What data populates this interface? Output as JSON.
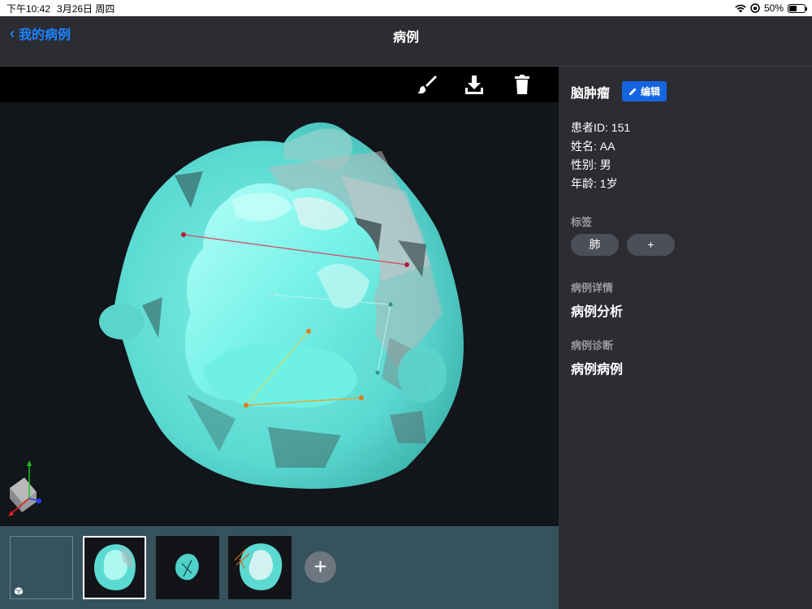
{
  "status_bar": {
    "time": "下午10:42",
    "date": "3月26日 周四",
    "battery": "50%",
    "battery_level": 0.5
  },
  "nav": {
    "back_label": "我的病例",
    "title": "病例"
  },
  "toolbar": {
    "icons": [
      "brush-icon",
      "download-icon",
      "trash-icon"
    ]
  },
  "panel": {
    "diagnosis_title": "脑肿瘤",
    "edit_label": "编辑",
    "patient_id": "患者ID: 151",
    "name": "姓名: AA",
    "gender": "性别: 男",
    "age": "年龄: 1岁",
    "tags_header": "标签",
    "tags": [
      "肺"
    ],
    "add_tag_label": "+",
    "details_header": "病例详情",
    "details_value": "病例分析",
    "diagnosis_header": "病例诊断",
    "diagnosis_value": "病例病例"
  },
  "thumbnails": {
    "add_label": "+"
  },
  "colors": {
    "accent": "#1a84ff",
    "edit_button": "#1565e0",
    "model": "#5fe3d9",
    "thumb_strip": "#35525d"
  }
}
